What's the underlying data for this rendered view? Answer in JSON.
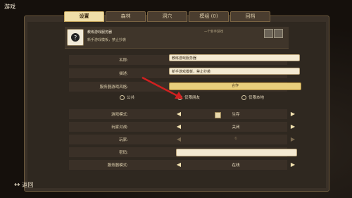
{
  "window_title": "游戏",
  "tabs": [
    {
      "label": "设置",
      "active": true
    },
    {
      "label": "森林",
      "active": false
    },
    {
      "label": "洞穴",
      "active": false
    },
    {
      "label": "模组 (0)",
      "active": false
    },
    {
      "label": "回档",
      "active": false
    }
  ],
  "header": {
    "name": "教练游戏服务器",
    "desc": "新手游戏模板，禁止抄袭",
    "meta": "一个新手游戏"
  },
  "form": {
    "name_label": "名称:",
    "name_value": "教练游戏服务器",
    "desc_label": "描述:",
    "desc_value": "新手游戏模板，禁止抄袭",
    "style_label": "服务器游戏风格:",
    "style_value": "合作"
  },
  "radios": [
    {
      "label": "公共",
      "selected": false
    },
    {
      "label": "仅限朋友",
      "selected": true
    },
    {
      "label": "仅限本地",
      "selected": false
    }
  ],
  "settings": {
    "mode_label": "游戏模式:",
    "mode_value": "生存",
    "pvp_label": "玩家对战:",
    "pvp_value": "关闭",
    "players_label": "玩家:",
    "players_value": "6",
    "password_label": "密码:",
    "server_mode_label": "服务器模式:",
    "server_mode_value": "在线"
  },
  "back_label": "返回"
}
